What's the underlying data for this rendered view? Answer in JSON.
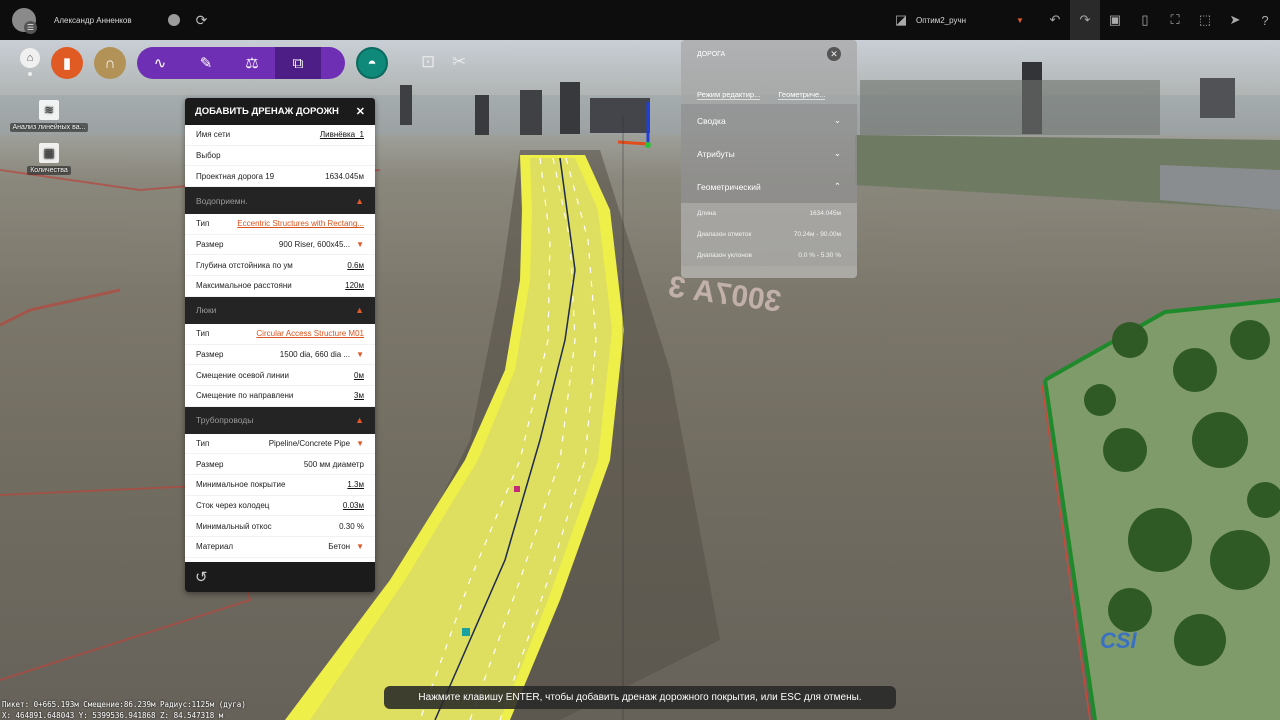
{
  "topbar": {
    "user_name": "Александр Анненков",
    "project_name": "Оптим2_ручн"
  },
  "toolbar": {
    "left_tools": [
      {
        "label": "Анализ линейных ва..."
      },
      {
        "label": "Количества"
      }
    ]
  },
  "drainage_panel": {
    "title": "ДОБАВИТЬ ДРЕНАЖ ДОРОЖН",
    "top_rows": [
      {
        "label": "Имя сети",
        "value": "Ливнёвка_1"
      },
      {
        "label": "Выбор",
        "value": ""
      },
      {
        "label": "Проектная дорога 19",
        "value": "1634.045м"
      }
    ],
    "sections": [
      {
        "title": "Водоприемн.",
        "rows": [
          {
            "label": "Тип",
            "value": "Eccentric Structures with Rectang..."
          },
          {
            "label": "Размер",
            "value": "900 Riser, 600x45..."
          },
          {
            "label": "Глубина отстойника по ум",
            "value": "0.6м"
          },
          {
            "label": "Максимальное расстояни",
            "value": "120м"
          }
        ]
      },
      {
        "title": "Люки",
        "rows": [
          {
            "label": "Тип",
            "value": "Circular Access Structure M01"
          },
          {
            "label": "Размер",
            "value": "1500 dia, 660 dia ..."
          },
          {
            "label": "Смещение осевой линии",
            "value": "0м"
          },
          {
            "label": "Смещение по направлени",
            "value": "3м"
          }
        ]
      },
      {
        "title": "Трубопроводы",
        "rows": [
          {
            "label": "Тип",
            "value": "Pipeline/Concrete Pipe"
          },
          {
            "label": "Размер",
            "value": "500 мм диаметр"
          },
          {
            "label": "Минимальное покрытие",
            "value": "1.3м"
          },
          {
            "label": "Сток через колодец",
            "value": "0.03м"
          },
          {
            "label": "Минимальный откос",
            "value": "0.30 %"
          },
          {
            "label": "Материал",
            "value": "Бетон"
          }
        ]
      }
    ]
  },
  "road_panel": {
    "title": "ДОРОГА",
    "modes": [
      "Режим редактир...",
      "Геометриче..."
    ],
    "sections": [
      "Сводка",
      "Атрибуты",
      "Геометрический"
    ],
    "rows": [
      {
        "label": "Длина",
        "value": "1634.045м"
      },
      {
        "label": "Диапазон отметок",
        "value": "70.24м - 90.00м"
      },
      {
        "label": "Диапазон уклонов",
        "value": "0.0 % - 5.30 %"
      }
    ]
  },
  "status": {
    "message": "Нажмите клавишу ENTER, чтобы добавить дренаж дорожного покрытия, или ESC для отмены.",
    "coords_line1": "Пикет: 0+665.193м Смещение:86.239м Радиус:1125м (дуга)",
    "coords_line2": "X: 464891.648043 Y: 5399536.941868 Z: 84.547318 м"
  },
  "scene": {
    "ground_text": "3007А 3"
  }
}
